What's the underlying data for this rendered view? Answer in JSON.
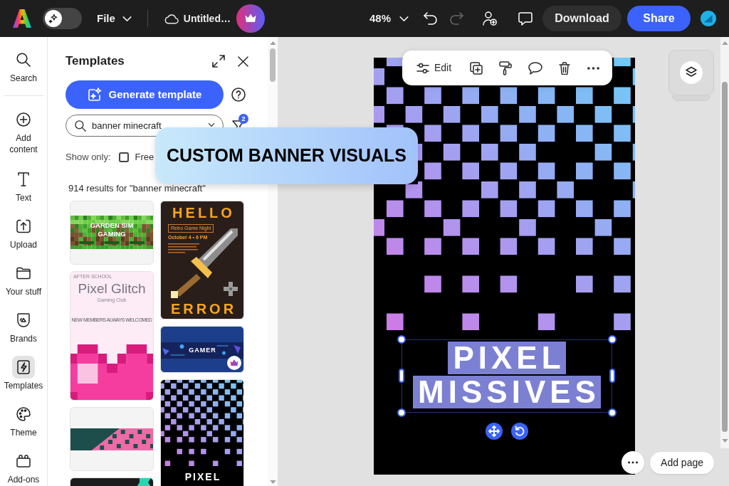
{
  "top_bar": {
    "ai_toggle": {
      "on": false
    },
    "file_menu": "File",
    "document_title": "Untitled…",
    "zoom": "48%",
    "history": [
      {
        "disabled": false
      },
      {
        "disabled": true
      }
    ],
    "download": "Download",
    "share": "Share"
  },
  "rail": {
    "items": [
      {
        "label": "Search",
        "selected": false
      },
      {
        "label": "Add content",
        "selected": false
      },
      {
        "label": "Text",
        "selected": false
      },
      {
        "label": "Upload",
        "selected": false
      },
      {
        "label": "Your stuff",
        "selected": false
      },
      {
        "label": "Brands",
        "selected": false
      },
      {
        "label": "Templates",
        "selected": true
      },
      {
        "label": "Theme",
        "selected": false
      },
      {
        "label": "Add-ons",
        "selected": false
      }
    ]
  },
  "templates_panel": {
    "title": "Templates",
    "generate_button": "Generate template",
    "search": {
      "value": "banner minecraft"
    },
    "filter_badge": "2",
    "show_only": {
      "label": "Show only:",
      "options": [
        {
          "label": "Free",
          "checked": false
        }
      ]
    },
    "results_summary": "914 results for \"banner minecraft\"",
    "results": [
      {
        "items": [
          {
            "kind": "garden",
            "texts": [
              "GARDEN SIM GAMING"
            ],
            "premium": false
          },
          {
            "kind": "glitch",
            "texts": [
              "AFTER SCHOOL",
              "Pixel Glitch",
              "Gaming Club",
              "NEW MEMBERS ALWAYS WELCOMED"
            ],
            "premium": false
          },
          {
            "kind": "bloc",
            "premium": false
          },
          {
            "kind": "dark"
          }
        ]
      },
      {
        "items": [
          {
            "kind": "hello",
            "texts": [
              "HELLO",
              "Retro Game Night",
              "October 4 • 6 PM",
              "ERROR"
            ],
            "premium": false
          },
          {
            "kind": "gamer",
            "texts": [
              "GAMER"
            ],
            "premium": true
          },
          {
            "kind": "pixel",
            "texts": [
              "PIXEL"
            ]
          }
        ]
      }
    ]
  },
  "caption_banner": {
    "text": "CUSTOM BANNER VISUALS"
  },
  "canvas": {
    "toolbar": {
      "edit_label": "Edit"
    },
    "text_box": {
      "lines": [
        "PIXEL",
        "MISSIVES"
      ],
      "selected": true
    },
    "add_page": "Add page"
  }
}
